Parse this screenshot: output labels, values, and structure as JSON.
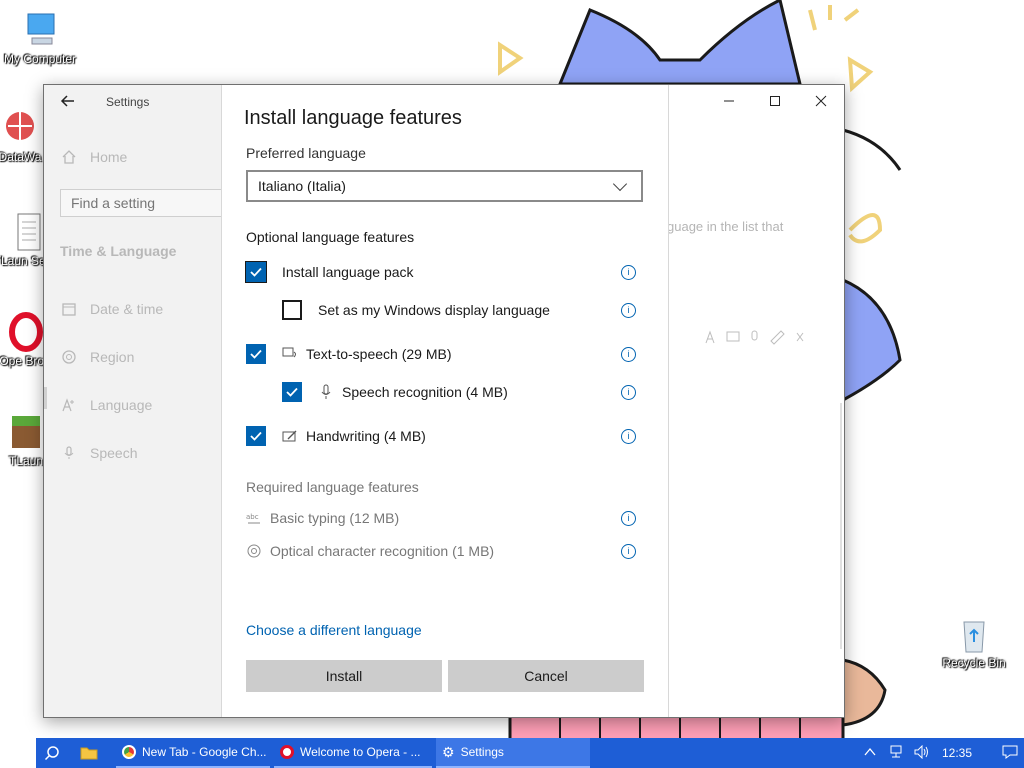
{
  "desktop": {
    "icons": [
      {
        "label": "My Computer"
      },
      {
        "label": "DataWa"
      },
      {
        "label": "TLaun Setup"
      },
      {
        "label": "Ope Brow"
      },
      {
        "label": "TLaun"
      },
      {
        "label": "Recycle Bin"
      }
    ]
  },
  "settings": {
    "app_title": "Settings",
    "home_label": "Home",
    "search_placeholder": "Find a setting",
    "section_title": "Time & Language",
    "nav_items": [
      {
        "label": "Date & time"
      },
      {
        "label": "Region"
      },
      {
        "label": "Language"
      },
      {
        "label": "Speech"
      }
    ],
    "background_partial_text": "guage in the list that"
  },
  "dialog": {
    "title": "Install language features",
    "preferred_language_label": "Preferred language",
    "preferred_language_value": "Italiano (Italia)",
    "optional_label": "Optional language features",
    "optional_features": [
      {
        "label": "Install language pack",
        "checked": true
      },
      {
        "label": "Set as my Windows display language",
        "checked": false
      },
      {
        "label": "Text-to-speech (29 MB)",
        "checked": true
      },
      {
        "label": "Speech recognition (4 MB)",
        "checked": true
      },
      {
        "label": "Handwriting (4 MB)",
        "checked": true
      }
    ],
    "required_label": "Required language features",
    "required_features": [
      {
        "label": "Basic typing (12 MB)"
      },
      {
        "label": "Optical character recognition (1 MB)"
      }
    ],
    "info_glyph": "i",
    "choose_link": "Choose a different language",
    "install_label": "Install",
    "cancel_label": "Cancel"
  },
  "taskbar": {
    "apps": [
      {
        "label": "New Tab - Google Ch..."
      },
      {
        "label": "Welcome to Opera - ..."
      },
      {
        "label": "Settings"
      }
    ],
    "clock": "12:35"
  },
  "colors": {
    "accent": "#0063b1",
    "taskbar": "#1e5ed6",
    "cat_blue": "#8fa3f5"
  }
}
